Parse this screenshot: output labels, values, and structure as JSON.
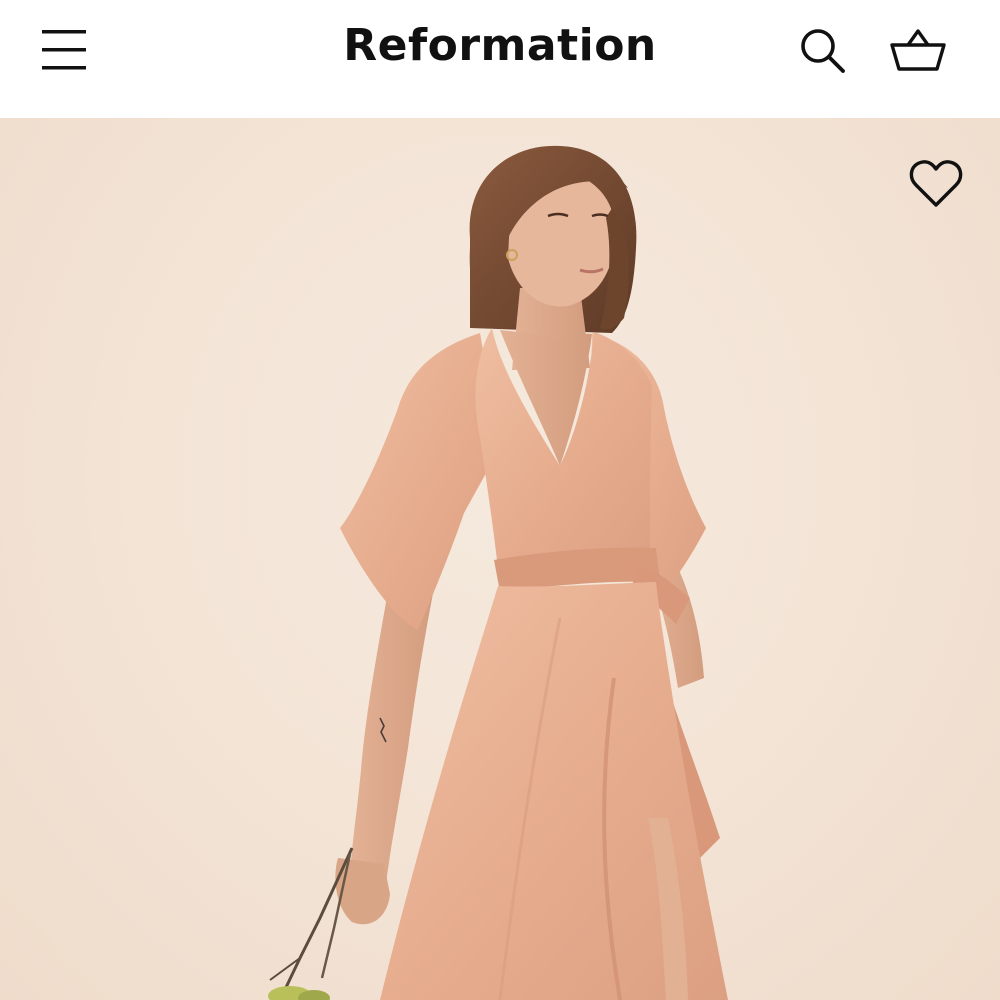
{
  "header": {
    "brand": "Reformation",
    "icons": {
      "menu": "hamburger-menu-icon",
      "search": "search-icon",
      "cart": "shopping-basket-icon"
    }
  },
  "product_image": {
    "wishlist_icon": "heart-outline-icon"
  },
  "colors": {
    "header_bg": "#ffffff",
    "text": "#111111",
    "background": "#f3e4d6",
    "dress": "#e9b295"
  }
}
